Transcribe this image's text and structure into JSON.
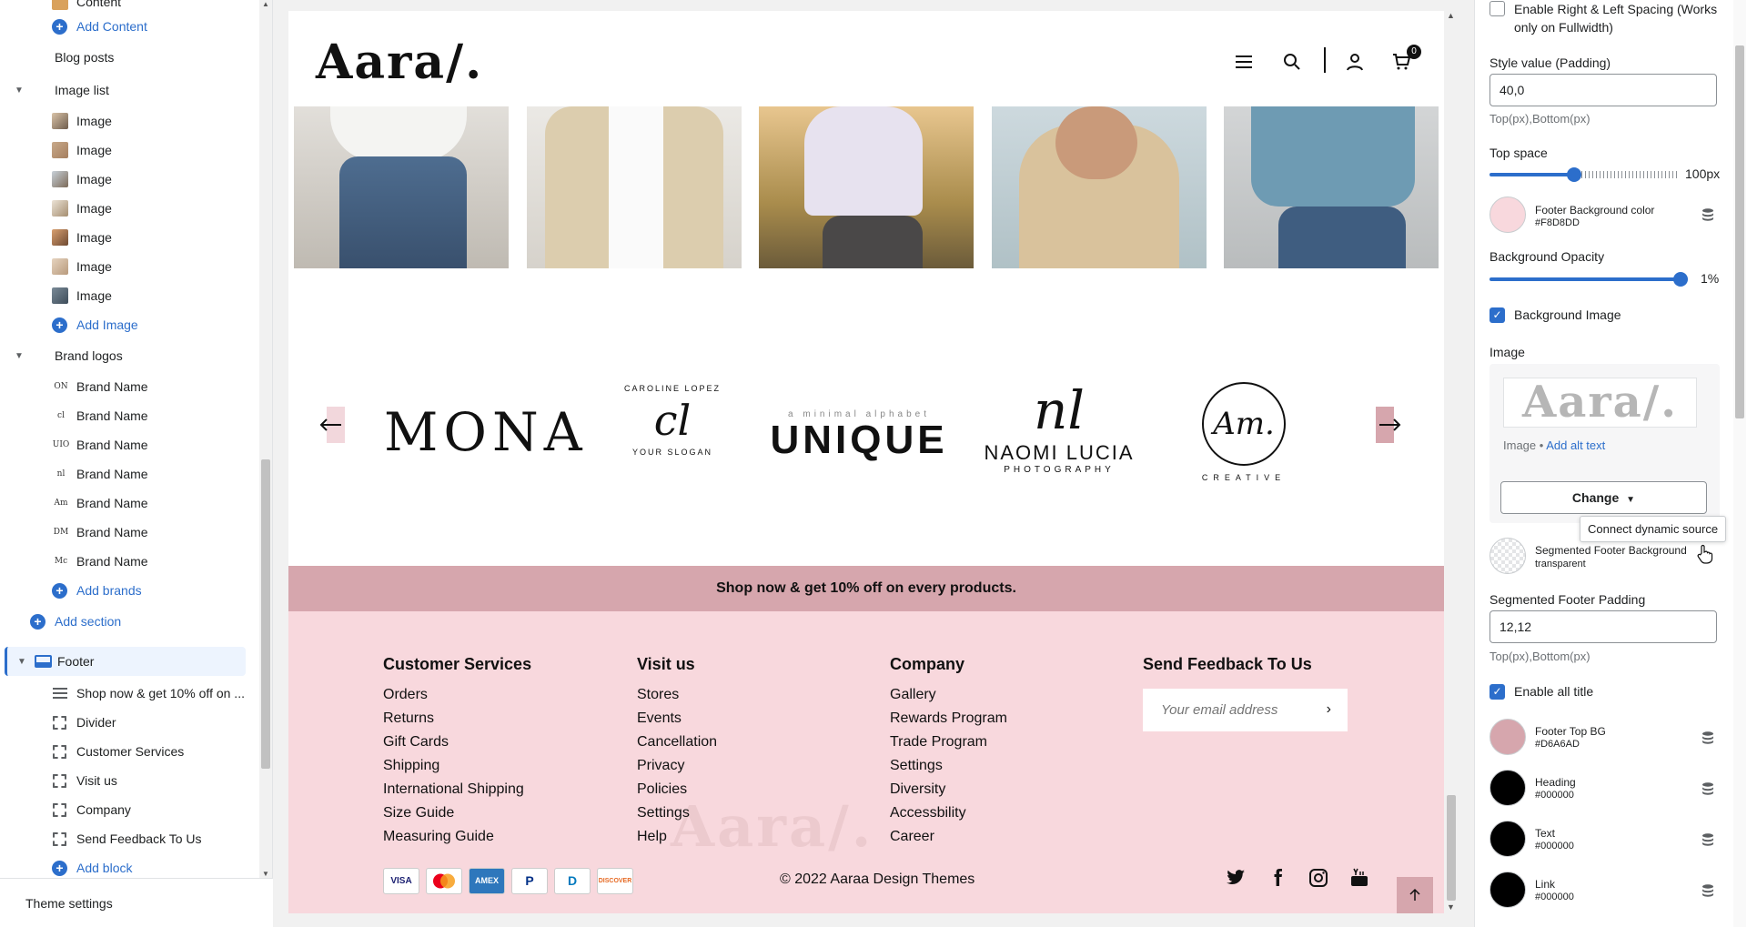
{
  "left_panel": {
    "top_item": "Content",
    "add_content": "Add Content",
    "blog_posts": "Blog posts",
    "image_list": "Image list",
    "images": [
      "Image",
      "Image",
      "Image",
      "Image",
      "Image",
      "Image",
      "Image"
    ],
    "add_image": "Add Image",
    "brand_logos": "Brand logos",
    "brands": [
      "Brand Name",
      "Brand Name",
      "Brand Name",
      "Brand Name",
      "Brand Name",
      "Brand Name",
      "Brand Name"
    ],
    "add_brands": "Add brands",
    "add_section": "Add section",
    "footer": "Footer",
    "footer_blocks": [
      "Shop now & get 10% off on ...",
      "Divider",
      "Customer Services",
      "Visit us",
      "Company",
      "Send Feedback To Us"
    ],
    "add_block": "Add block",
    "theme_settings": "Theme settings"
  },
  "preview": {
    "logo": "Aara/.",
    "cart_count": "0",
    "brand_logos": {
      "mona": "MONA",
      "caroline_top": "CAROLINE LOPEZ",
      "caroline_mid": "cl",
      "caroline_bottom": "YOUR SLOGAN",
      "unique_small": "a minimal alphabet",
      "unique": "UNIQUE",
      "naomi_script": "nl",
      "naomi": "NAOMI LUCIA",
      "naomi_sub": "PHOTOGRAPHY",
      "am": "Am.",
      "creative": "CREATIVE"
    },
    "promo": "Shop now & get 10% off on every products.",
    "footer": {
      "columns": [
        {
          "title": "Customer Services",
          "links": [
            "Orders",
            "Returns",
            "Gift Cards",
            "Shipping",
            "International Shipping",
            "Size Guide",
            "Measuring Guide"
          ]
        },
        {
          "title": "Visit us",
          "links": [
            "Stores",
            "Events",
            "Cancellation",
            "Privacy",
            "Policies",
            "Settings",
            "Help"
          ]
        },
        {
          "title": "Company",
          "links": [
            "Gallery",
            "Rewards Program",
            "Trade Program",
            "Settings",
            "Diversity",
            "Accessbility",
            "Career"
          ]
        }
      ],
      "feedback_title": "Send Feedback To Us",
      "email_placeholder": "Your email address",
      "watermark": "Aara/.",
      "payments": [
        "VISA",
        "MC",
        "AMEX",
        "P",
        "D",
        "DISCOVER"
      ],
      "copyright": "© 2022 Aaraa Design Themes"
    }
  },
  "right_panel": {
    "enable_spacing": "Enable Right & Left Spacing (Works only on Fullwidth)",
    "style_value_label": "Style value (Padding)",
    "style_value": "40,0",
    "style_hint": "Top(px),Bottom(px)",
    "top_space_label": "Top space",
    "top_space_value": "100px",
    "top_space_fraction": 0.45,
    "footer_bg_label": "Footer Background color",
    "footer_bg_value": "#F8D8DD",
    "bg_opacity_label": "Background Opacity",
    "bg_opacity_value": "1%",
    "bg_image_label": "Background Image",
    "image_label": "Image",
    "image_preview": "Aara/.",
    "image_meta": "Image",
    "add_alt": "Add alt text",
    "change": "Change",
    "tooltip": "Connect dynamic source",
    "segmented_bg_label": "Segmented Footer Background",
    "segmented_bg_value": "transparent",
    "segmented_padding_label": "Segmented Footer Padding",
    "segmented_padding_value": "12,12",
    "segmented_hint": "Top(px),Bottom(px)",
    "enable_title": "Enable all title",
    "footer_top_bg_label": "Footer Top BG",
    "footer_top_bg_value": "#D6A6AD",
    "heading_label": "Heading",
    "heading_value": "#000000",
    "text_label": "Text",
    "text_value": "#000000",
    "link_label": "Link",
    "link_value": "#000000"
  },
  "colors": {
    "accent": "#2c6ecb",
    "footer_bg": "#F8D8DD",
    "footer_top_bg": "#D6A6AD"
  }
}
